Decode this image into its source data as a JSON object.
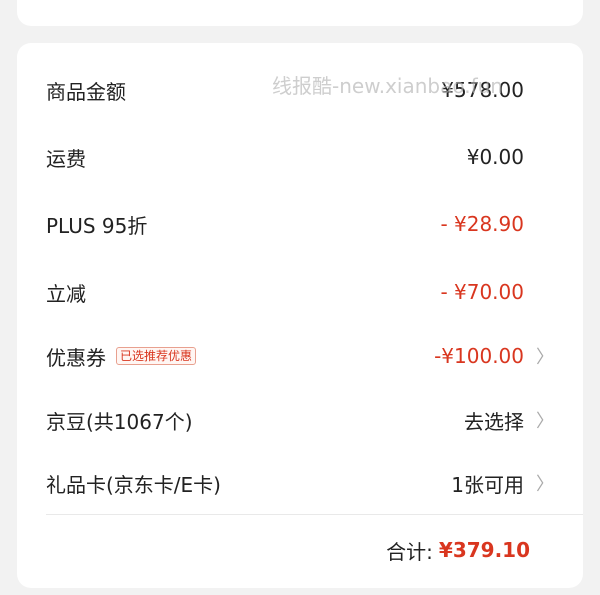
{
  "rows": [
    {
      "label": "商品金额",
      "value": "¥578.00",
      "red": false,
      "chevron": false
    },
    {
      "label": "运费",
      "value": "¥0.00",
      "red": false,
      "chevron": false
    },
    {
      "label": "PLUS 95折",
      "value": "- ¥28.90",
      "red": true,
      "chevron": false
    },
    {
      "label": "立减",
      "value": "- ¥70.00",
      "red": true,
      "chevron": false
    },
    {
      "label": "优惠券",
      "badge": "已选推荐优惠",
      "value": "-¥100.00",
      "red": true,
      "chevron": true
    },
    {
      "label": "京豆(共1067个)",
      "value": "去选择",
      "red": false,
      "chevron": true
    },
    {
      "label": "礼品卡(京东卡/E卡)",
      "value": "1张可用",
      "red": false,
      "chevron": true
    }
  ],
  "chevron_glyph": "〉",
  "watermark": "线报酷-new.xianbao.fun",
  "total": {
    "label": "合计:",
    "value": "¥379.10"
  },
  "colors": {
    "accent": "#d9361f",
    "background": "#f2f2f2",
    "card": "#ffffff"
  }
}
